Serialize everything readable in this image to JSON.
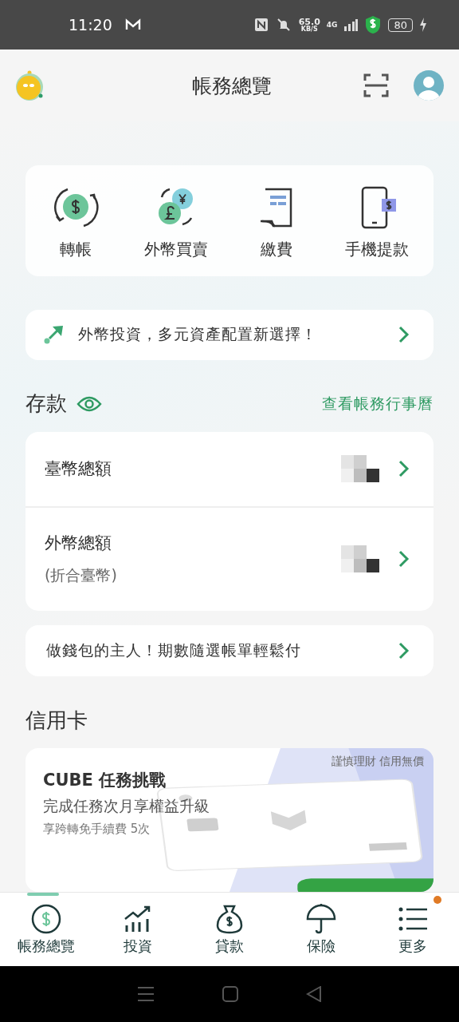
{
  "status_bar": {
    "time": "11:20",
    "speed": "65.0",
    "speed_unit": "KB/S",
    "network": "4G",
    "battery": "80"
  },
  "header": {
    "title": "帳務總覽"
  },
  "quick_actions": [
    {
      "label": "轉帳",
      "kind": "transfer"
    },
    {
      "label": "外幣買賣",
      "kind": "exchange"
    },
    {
      "label": "繳費",
      "kind": "bill"
    },
    {
      "label": "手機提款",
      "kind": "withdraw"
    }
  ],
  "promo": {
    "text": "外幣投資，多元資產配置新選擇！"
  },
  "deposits": {
    "title": "存款",
    "link": "查看帳務行事曆",
    "rows": [
      {
        "label": "臺幣總額"
      },
      {
        "label": "外幣總額",
        "note": "(折合臺幣)"
      }
    ]
  },
  "installment_promo": {
    "text": "做錢包的主人！期數隨選帳單輕鬆付"
  },
  "credit_card": {
    "title": "信用卡",
    "banner": {
      "slogan": "謹慎理財 信用無價",
      "headline": "CUBE 任務挑戰",
      "subtitle": "完成任務次月享權益升級",
      "detail": "享跨轉免手續費 5次",
      "kind": "picture"
    }
  },
  "bottom_nav": [
    {
      "label": "帳務總覽",
      "kind": "overview",
      "selected": true,
      "badge": false
    },
    {
      "label": "投資",
      "kind": "invest",
      "selected": false,
      "badge": false
    },
    {
      "label": "貸款",
      "kind": "loan",
      "selected": false,
      "badge": false
    },
    {
      "label": "保險",
      "kind": "insurance",
      "selected": false,
      "badge": false
    },
    {
      "label": "更多",
      "kind": "more",
      "selected": false,
      "badge": true
    }
  ]
}
